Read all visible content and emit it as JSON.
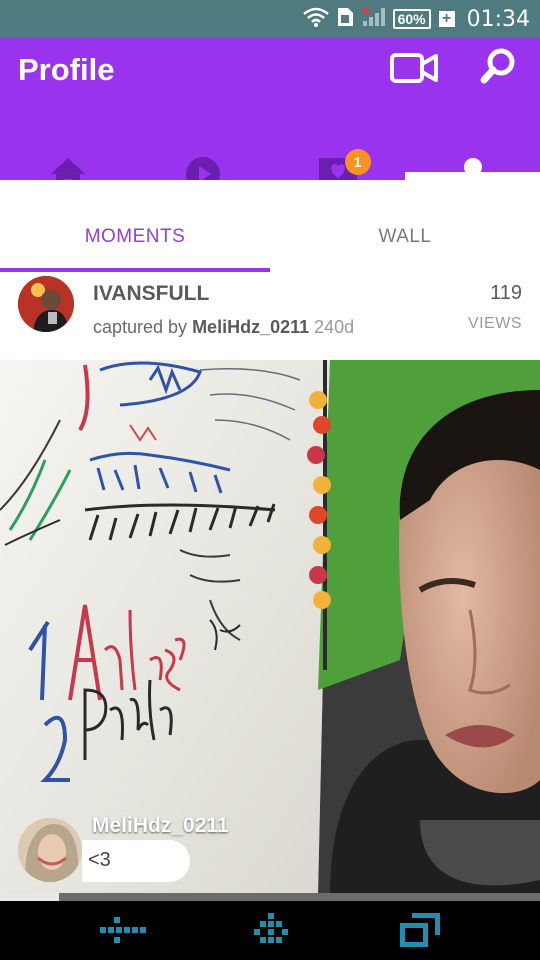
{
  "status_bar": {
    "battery": "60%",
    "time": "01:34"
  },
  "header": {
    "title": "Profile"
  },
  "nav": {
    "items": [
      {
        "name": "home"
      },
      {
        "name": "play"
      },
      {
        "name": "messages",
        "badge": "1"
      },
      {
        "name": "profile"
      }
    ]
  },
  "tabs": [
    {
      "label": "MOMENTS"
    },
    {
      "label": "WALL"
    }
  ],
  "moment": {
    "user": "IVANSFULL",
    "captured_prefix": "captured by ",
    "captured_by": "MeliHdz_0211",
    "age": "240d",
    "views": "119",
    "views_label": "VIEWS"
  },
  "comment": {
    "user": "MeliHdz_0211",
    "text": "<3"
  },
  "playback": {
    "progress": 0.11
  },
  "colors": {
    "accent": "#9933ee",
    "badge": "#f7931e",
    "status_bar": "#4f7a80"
  }
}
